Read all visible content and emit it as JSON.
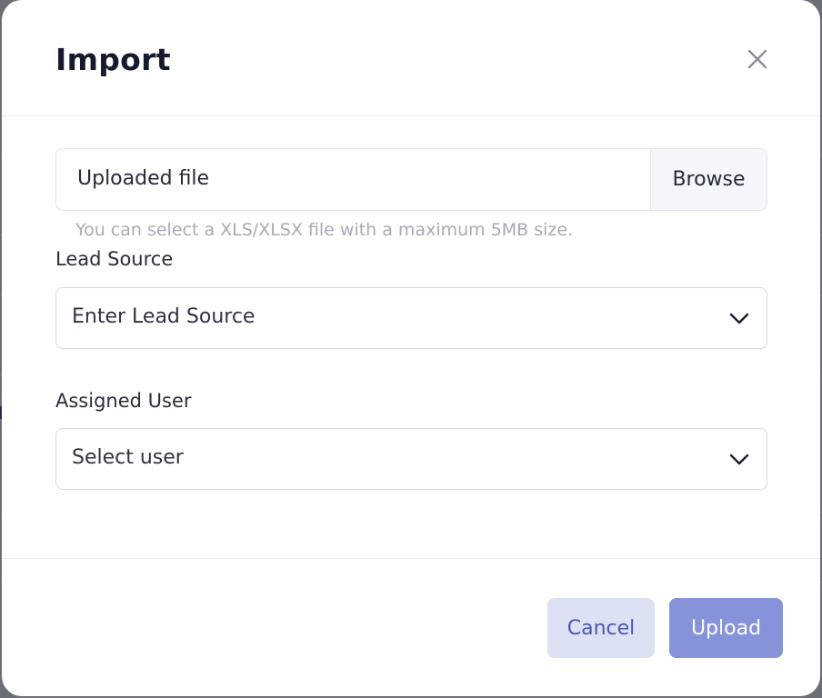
{
  "dialog": {
    "title": "Import"
  },
  "file_upload": {
    "placeholder": "Uploaded file",
    "browse_label": "Browse",
    "hint": "You can select a XLS/XLSX file with a maximum 5MB size."
  },
  "lead_source": {
    "label": "Lead Source",
    "placeholder": "Enter Lead Source"
  },
  "assigned_user": {
    "label": "Assigned User",
    "placeholder": "Select user"
  },
  "footer": {
    "cancel_label": "Cancel",
    "upload_label": "Upload"
  },
  "colors": {
    "primary": "#8793d8",
    "primary_light": "#dde1f4",
    "primary_text": "#4a57b3"
  },
  "icons": {
    "close": "close-icon",
    "dropdown": "chevron-down-icon"
  }
}
